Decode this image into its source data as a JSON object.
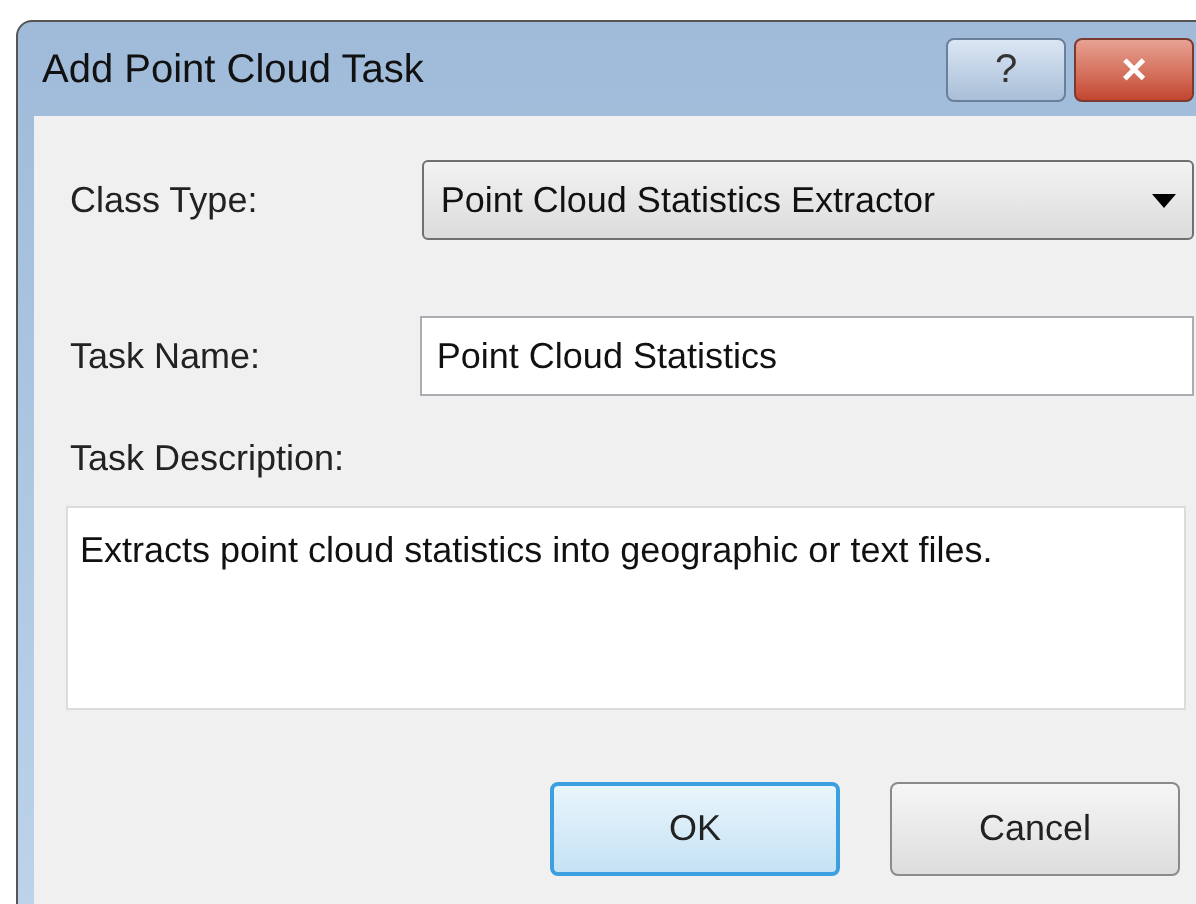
{
  "window": {
    "title": "Add Point Cloud Task",
    "title_buttons": [
      {
        "kind": "help",
        "label": "?"
      },
      {
        "kind": "close",
        "label": "×"
      }
    ]
  },
  "class_type": {
    "label": "Class Type:",
    "value": "Point Cloud Statistics Extractor"
  },
  "task_name": {
    "label": "Task Name:",
    "value": "Point Cloud Statistics"
  },
  "task_description": {
    "label": "Task Description:",
    "value": "Extracts point cloud statistics into geographic or text files."
  },
  "buttons": [
    {
      "label": "OK",
      "default": true
    },
    {
      "label": "Cancel",
      "default": false
    }
  ]
}
